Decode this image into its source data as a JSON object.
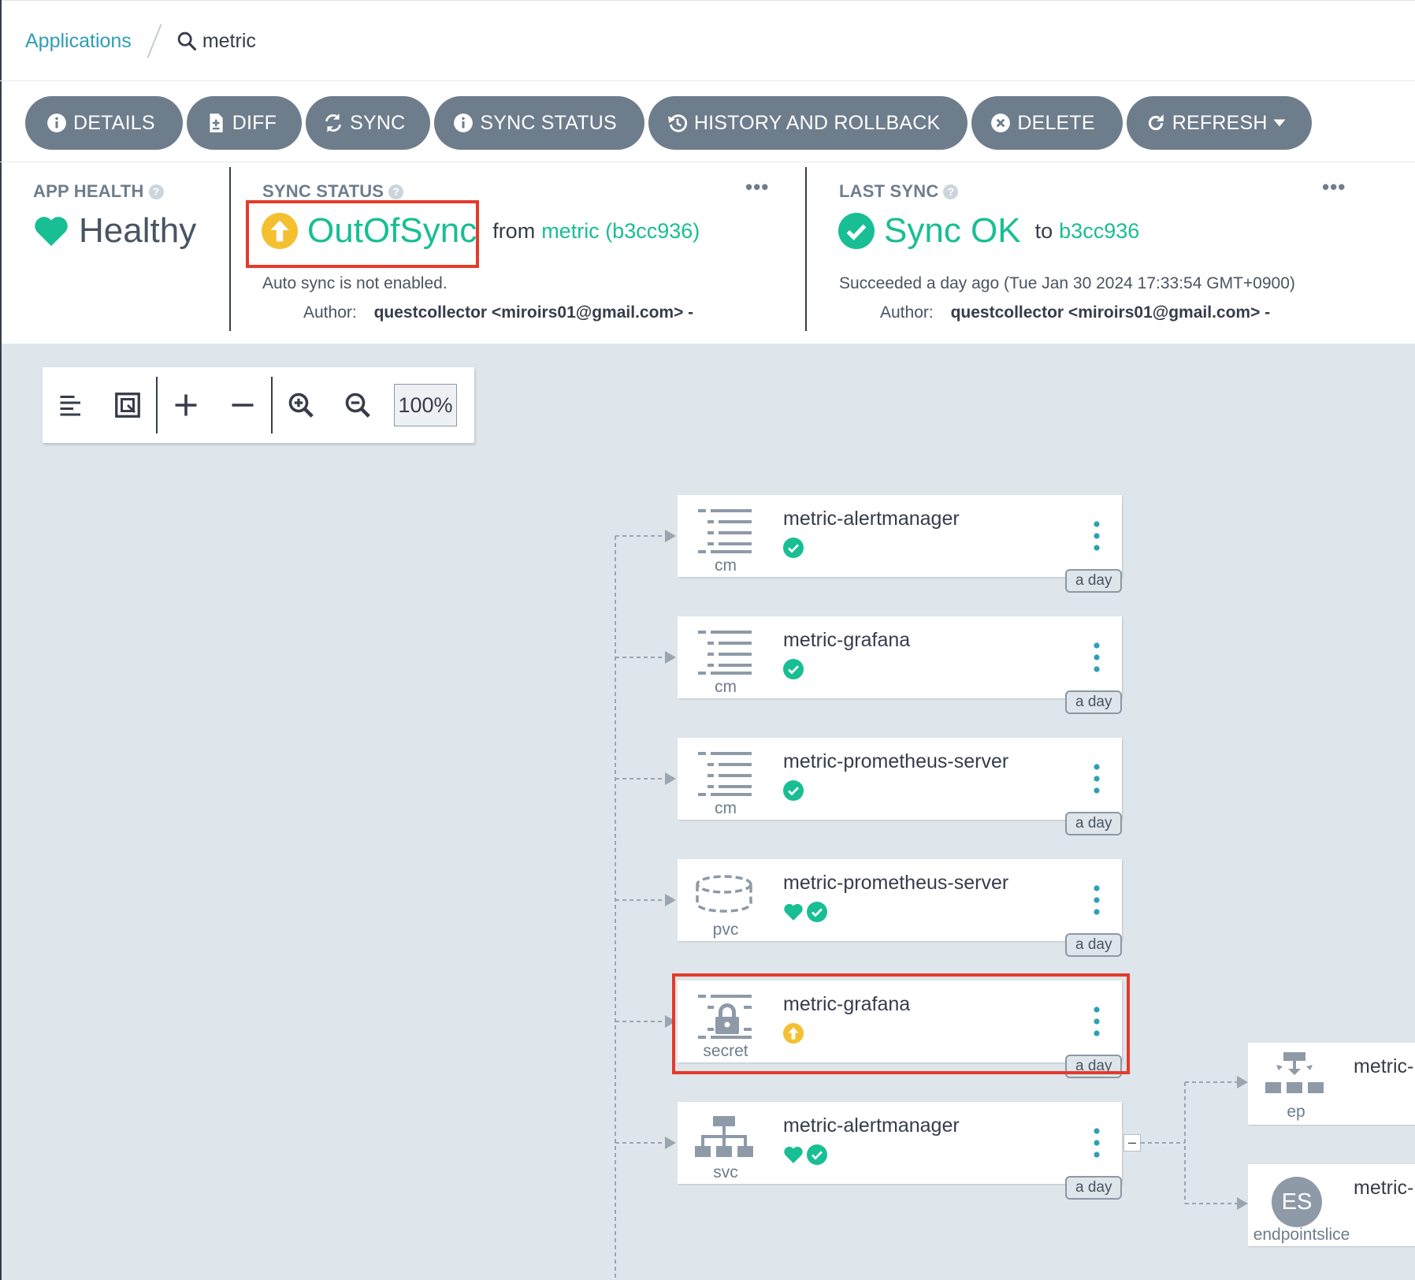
{
  "breadcrumb": {
    "root": "Applications",
    "current": "metric"
  },
  "toolbar": {
    "details": "DETAILS",
    "diff": "DIFF",
    "sync": "SYNC",
    "sync_status": "SYNC STATUS",
    "history": "HISTORY AND ROLLBACK",
    "delete": "DELETE",
    "refresh": "REFRESH"
  },
  "app_health": {
    "title": "APP HEALTH",
    "help": "?",
    "status": "Healthy"
  },
  "sync_status": {
    "title": "SYNC STATUS",
    "help": "?",
    "more": "•••",
    "status": "OutOfSync",
    "from_label": "from",
    "source": "metric (b3cc936)",
    "auto_sync": "Auto sync is not enabled.",
    "author_label": "Author:",
    "author": "questcollector <miroirs01@gmail.com> -"
  },
  "last_sync": {
    "title": "LAST SYNC",
    "help": "?",
    "more": "•••",
    "status": "Sync OK",
    "to_label": "to",
    "revision": "b3cc936",
    "detail": "Succeeded a day ago (Tue Jan 30 2024 17:33:54 GMT+0900)",
    "author_label": "Author:",
    "author": "questcollector <miroirs01@gmail.com> -"
  },
  "graph_toolbar": {
    "zoom": "100%"
  },
  "resources": [
    {
      "name": "metric-alertmanager",
      "kind": "cm",
      "age": "a day",
      "health": false,
      "sync": "synced"
    },
    {
      "name": "metric-grafana",
      "kind": "cm",
      "age": "a day",
      "health": false,
      "sync": "synced"
    },
    {
      "name": "metric-prometheus-server",
      "kind": "cm",
      "age": "a day",
      "health": false,
      "sync": "synced"
    },
    {
      "name": "metric-prometheus-server",
      "kind": "pvc",
      "age": "a day",
      "health": true,
      "sync": "synced"
    },
    {
      "name": "metric-grafana",
      "kind": "secret",
      "age": "a day",
      "health": false,
      "sync": "out-of-sync"
    },
    {
      "name": "metric-alertmanager",
      "kind": "svc",
      "age": "a day",
      "health": true,
      "sync": "synced"
    }
  ],
  "child_resources": [
    {
      "name": "metric-",
      "kind": "ep"
    },
    {
      "name": "metric-",
      "kind": "endpointslice",
      "badge": "ES"
    }
  ],
  "collapse_label": "–",
  "colors": {
    "accent": "#18be94",
    "link": "#2d9fb6",
    "warning": "#f4c030",
    "button": "#6e7d8c",
    "highlight": "#e53a2a"
  }
}
